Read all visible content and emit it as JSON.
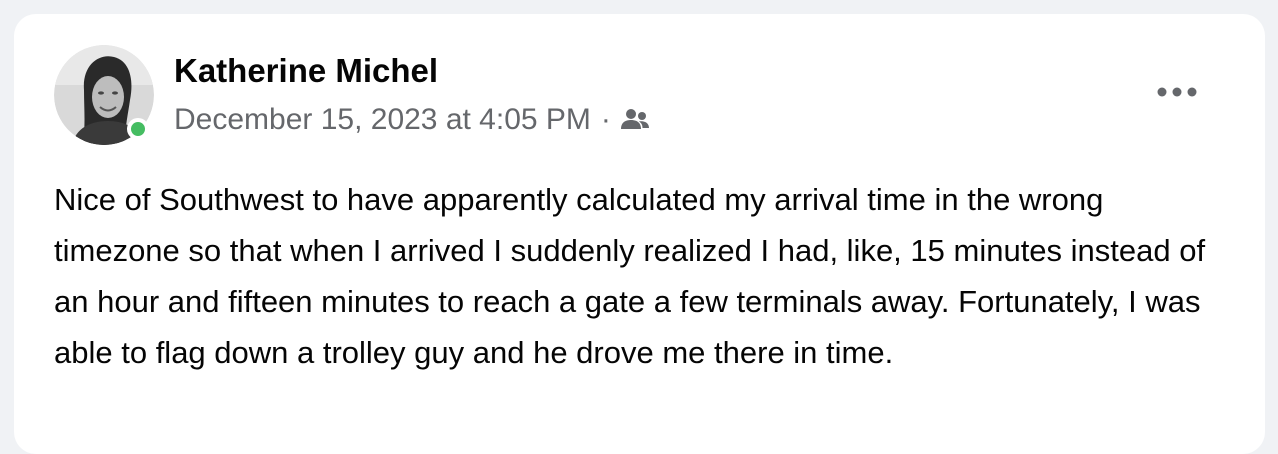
{
  "post": {
    "author": "Katherine Michel",
    "timestamp": "December 15, 2023 at 4:05 PM",
    "separator": "·",
    "audience_icon": "friends-icon",
    "more_icon": "more-options-icon",
    "online_status_color": "#45bd62",
    "text": "Nice of Southwest to have apparently calculated my arrival time in the wrong timezone so that when I arrived I suddenly realized I had, like, 15 minutes instead of an hour and fifteen minutes to reach a gate a few terminals away. Fortunately, I was able to flag down a trolley guy and he drove me there in time."
  }
}
